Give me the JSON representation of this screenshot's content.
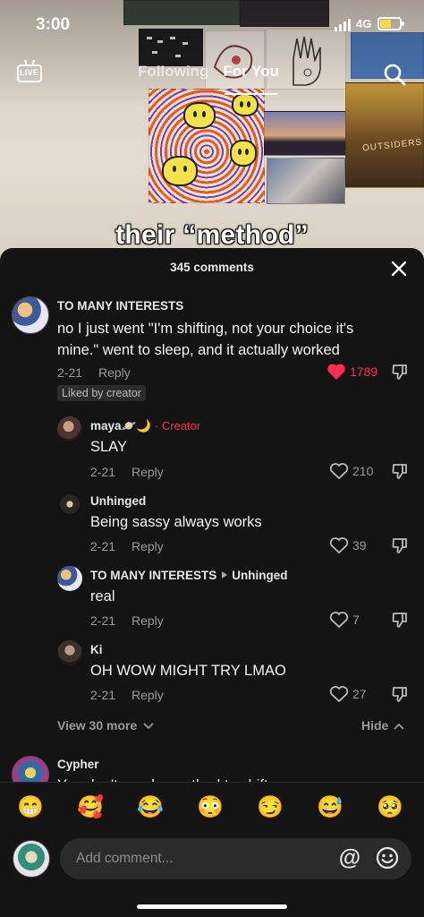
{
  "status_bar": {
    "time": "3:00",
    "network": "4G"
  },
  "top_nav": {
    "live_label": "LIVE",
    "tabs": [
      {
        "label": "Following",
        "active": false
      },
      {
        "label": "For You",
        "active": true
      }
    ]
  },
  "video": {
    "caption": "their “method”",
    "poster_text": "OUTSIDERS"
  },
  "comments_sheet": {
    "title": "345 comments",
    "comments": [
      {
        "username": "TO MANY INTERESTS",
        "text": "no I just went \"I'm shifting, not your choice it's mine.\" went to sleep, and it actually worked",
        "date": "2-21",
        "reply_label": "Reply",
        "likes": "1789",
        "liked": true,
        "badge": "Liked by creator"
      }
    ],
    "replies": [
      {
        "username": "maya",
        "emoji": "🪐🌙",
        "creator_tag": "Creator",
        "text": "SLAY",
        "date": "2-21",
        "reply_label": "Reply",
        "likes": "210"
      },
      {
        "username": "Unhinged",
        "text": "Being sassy always works",
        "date": "2-21",
        "reply_label": "Reply",
        "likes": "39"
      },
      {
        "username": "TO MANY INTERESTS",
        "reply_to": "Unhinged",
        "text": "real",
        "date": "2-21",
        "reply_label": "Reply",
        "likes": "7"
      },
      {
        "username": "Ki",
        "text": "OH WOW MIGHT TRY LMAO",
        "date": "2-21",
        "reply_label": "Reply",
        "likes": "27"
      }
    ],
    "view_more": "View 30 more",
    "hide": "Hide",
    "next_comment": {
      "username": "Cypher",
      "text": "You don't need a method to shift"
    }
  },
  "emoji_bar": [
    "😁",
    "🥰",
    "😂",
    "😳",
    "😏",
    "😅",
    "🥺"
  ],
  "input": {
    "placeholder": "Add comment...",
    "mention_symbol": "@"
  },
  "colors": {
    "accent": "#fe2c55",
    "sheet_bg": "#141414",
    "input_bg": "#2a2a2a",
    "battery": "#f8d94a"
  }
}
